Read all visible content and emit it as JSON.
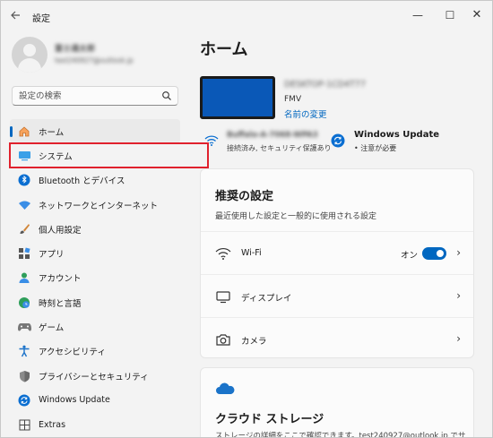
{
  "window": {
    "title": "設定",
    "back_icon": "back-arrow-icon",
    "minimize_glyph": "—",
    "maximize_glyph": "☐",
    "close_glyph": "✕"
  },
  "profile": {
    "name": "富士通太郎",
    "email": "test240927@outlook.jp"
  },
  "search": {
    "placeholder": "設定の検索"
  },
  "sidebar": {
    "items": [
      {
        "label": "ホーム",
        "icon": "home-icon",
        "active": true
      },
      {
        "label": "システム",
        "icon": "system-icon",
        "active": false
      },
      {
        "label": "Bluetooth とデバイス",
        "icon": "bluetooth-icon",
        "active": false
      },
      {
        "label": "ネットワークとインターネット",
        "icon": "network-icon",
        "active": false
      },
      {
        "label": "個人用設定",
        "icon": "brush-icon",
        "active": false
      },
      {
        "label": "アプリ",
        "icon": "apps-icon",
        "active": false
      },
      {
        "label": "アカウント",
        "icon": "account-icon",
        "active": false
      },
      {
        "label": "時刻と言語",
        "icon": "time-language-icon",
        "active": false
      },
      {
        "label": "ゲーム",
        "icon": "gamepad-icon",
        "active": false
      },
      {
        "label": "アクセシビリティ",
        "icon": "accessibility-icon",
        "active": false
      },
      {
        "label": "プライバシーとセキュリティ",
        "icon": "shield-icon",
        "active": false
      },
      {
        "label": "Windows Update",
        "icon": "windows-update-icon",
        "active": false
      },
      {
        "label": "Extras",
        "icon": "extras-icon",
        "active": false
      }
    ]
  },
  "main": {
    "title": "ホーム",
    "device": {
      "name": "DESKTOP-1CD4T77",
      "model": "FMV",
      "rename_link": "名前の変更"
    },
    "network": {
      "name": "Buffalo-A-7068-WPA3",
      "status": "接続済み, セキュリティ保護あり"
    },
    "windows_update": {
      "title": "Windows Update",
      "status": "• 注意が必要"
    },
    "recommended": {
      "title": "推奨の設定",
      "subtitle": "最近使用した設定と一般的に使用される設定",
      "rows": [
        {
          "label": "Wi-Fi",
          "icon": "wifi-icon",
          "toggle_label": "オン",
          "toggle_on": true
        },
        {
          "label": "ディスプレイ",
          "icon": "display-icon"
        },
        {
          "label": "カメラ",
          "icon": "camera-icon"
        }
      ]
    },
    "cloud": {
      "title": "クラウド ストレージ",
      "subtitle": "ストレージの詳細をここで確認できます。test240927@outlook.jp でサ"
    }
  },
  "colors": {
    "accent": "#0067c0",
    "highlight_box": "#e0212d",
    "device_screen": "#0a58b7"
  }
}
